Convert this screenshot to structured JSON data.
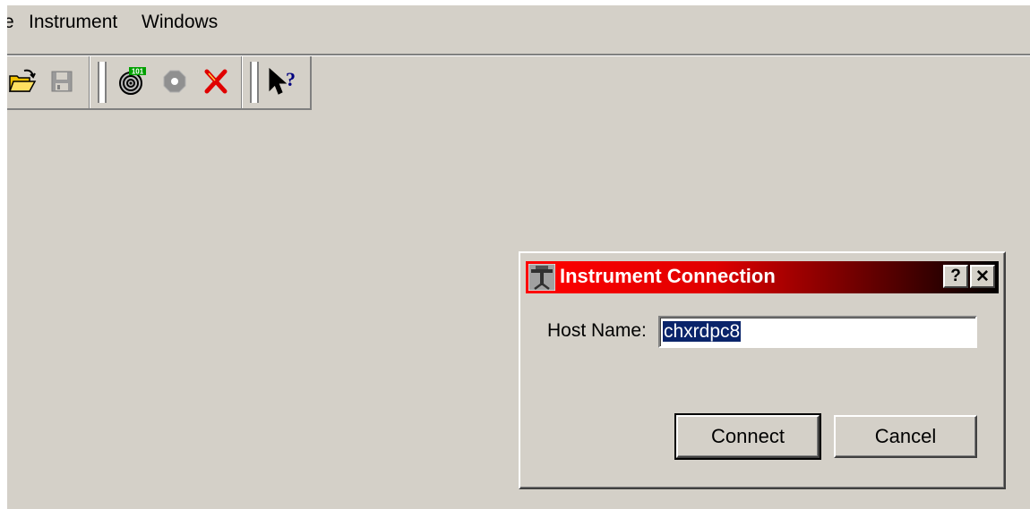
{
  "menu": {
    "items": [
      "e",
      "Instrument",
      "Windows"
    ]
  },
  "toolbar": {
    "buttons": [
      "open-folder-icon",
      "save-icon",
      "instrument-scan-icon",
      "stop-icon",
      "delete-icon",
      "help-pointer-icon"
    ],
    "scan_badge": "101",
    "help_glyph": "?"
  },
  "dialog": {
    "title": "Instrument Connection",
    "help_button": "?",
    "close_button": "✕",
    "host_label": "Host Name:",
    "host_value": "chxrdpc8",
    "connect_label": "Connect",
    "cancel_label": "Cancel"
  },
  "colors": {
    "face": "#d4d0c8",
    "title_start": "#ff0000",
    "title_end": "#000000",
    "selection": "#0a246a"
  }
}
